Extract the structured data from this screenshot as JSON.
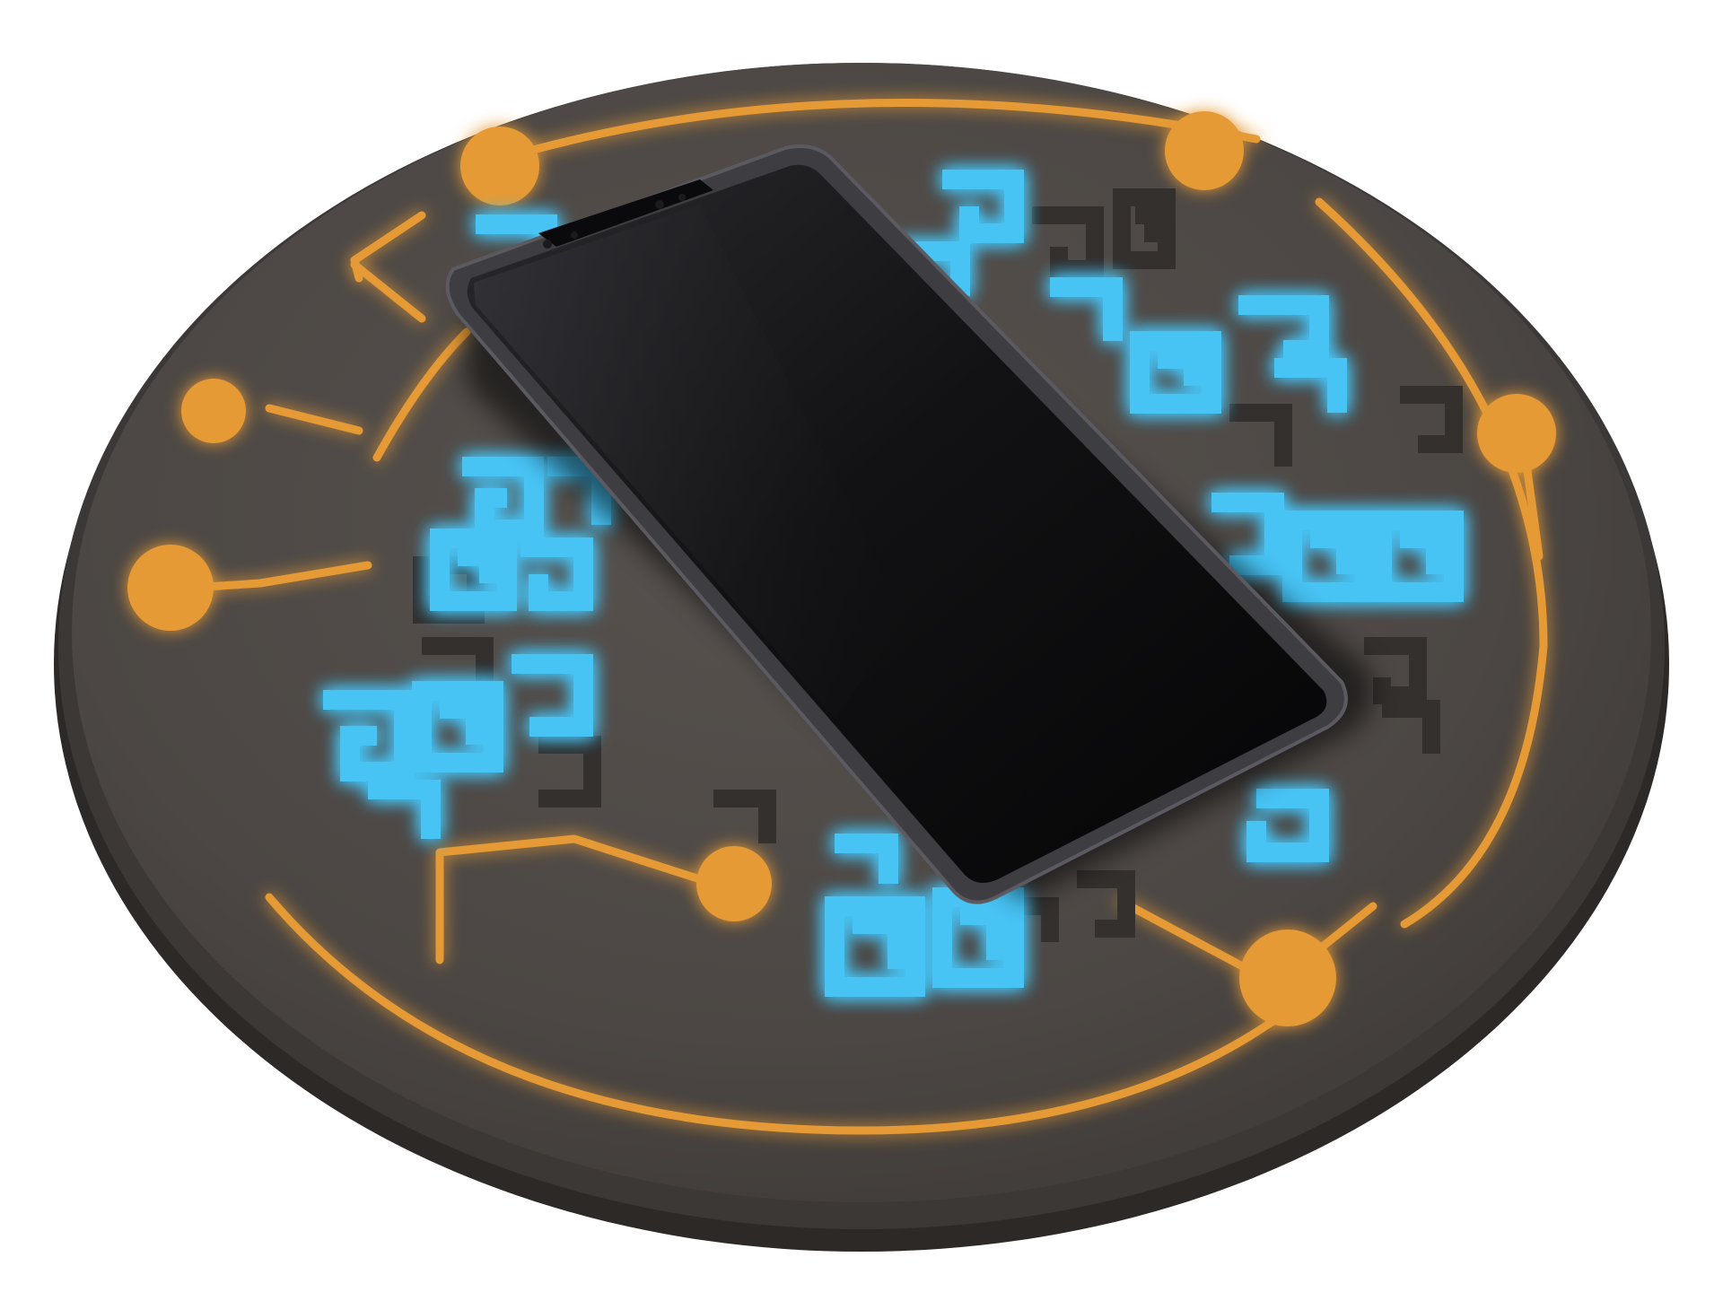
{
  "scene": {
    "subject": "wireless-charging-pad-with-smartphone",
    "colors": {
      "background": "#ffffff",
      "pad_body": "#4a4643",
      "pad_edge": "#3b3836",
      "pad_top": "#514c48",
      "circuit_orange": "#e69a35",
      "circuit_glow": "#ffb050",
      "glyph_blue": "#46c3f4",
      "glyph_glow": "#2aa6ee",
      "glyph_engraved": "#363230",
      "phone_frame": "#3e3e42",
      "phone_screen": "#0b0b0d"
    }
  }
}
